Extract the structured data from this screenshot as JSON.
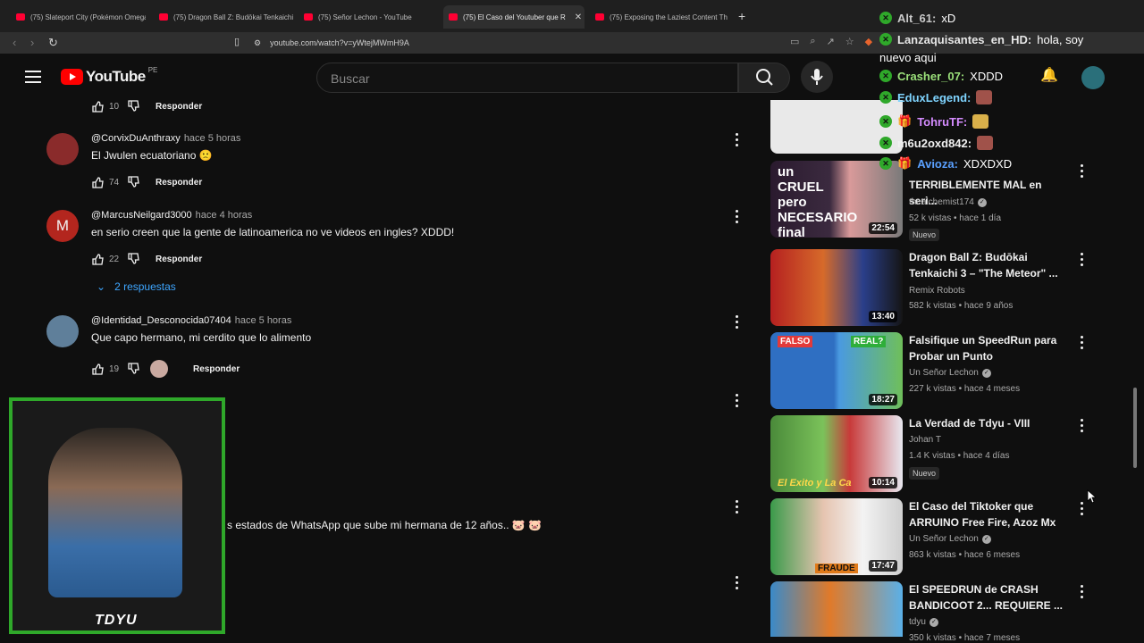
{
  "browser": {
    "tabs": [
      {
        "label": "(75) Slateport City (Pokémon Omega"
      },
      {
        "label": "(75) Dragon Ball Z: Budōkai Tenkaichi"
      },
      {
        "label": "(75) Señor Lechon - YouTube"
      },
      {
        "label": "(75) El Caso del Youtuber que R"
      },
      {
        "label": "(75) Exposing the Laziest Content Th"
      }
    ],
    "new_tab": "+",
    "url": "youtube.com/watch?v=yWtejMWmH9A"
  },
  "header": {
    "logo_text": "YouTube",
    "country": "PE",
    "search_placeholder": "Buscar"
  },
  "comments": {
    "top_likes": "10",
    "reply_label": "Responder",
    "items": [
      {
        "author": "@CorvixDuAnthraxy",
        "time": "hace 5 horas",
        "text": "El Jwulen ecuatoriano 🙁",
        "likes": "74"
      },
      {
        "author": "@MarcusNeilgard3000",
        "time": "hace 4 horas",
        "text": "en serio creen que la gente de latinoamerica no ve videos en ingles? XDDD!",
        "likes": "22",
        "avatar_letter": "M"
      },
      {
        "author": "@Identidad_Desconocida07404",
        "time": "hace 5 horas",
        "text": "Que capo hermano, mi cerdito que lo alimento",
        "likes": "19"
      }
    ],
    "replies_toggle": "2 respuestas",
    "partial_text": "s estados de WhatsApp que sube mi hermana de 12 años.. 🐷 🐷"
  },
  "sidebar": {
    "videos": [
      {
        "title": "TERRIBLEMENTE MAL en seri...",
        "channel": "thealchemist174",
        "meta": "52 k vistas • hace 1 día",
        "badge": "Nuevo",
        "duration": "22:54"
      },
      {
        "title": "Dragon Ball Z: Budōkai Tenkaichi 3 – \"The Meteor\" ...",
        "channel": "Remix Robots",
        "meta": "582 k vistas • hace 9 años",
        "duration": "13:40"
      },
      {
        "title": "Falsifique un SpeedRun para Probar un Punto",
        "channel": "Un Señor Lechon",
        "meta": "227 k vistas • hace 4 meses",
        "duration": "18:27"
      },
      {
        "title": "La Verdad de Tdyu - VIII",
        "channel": "Johan T",
        "meta": "1.4 K vistas • hace 4 días",
        "badge": "Nuevo",
        "duration": "10:14"
      },
      {
        "title": "El Caso del Tiktoker que ARRUINO Free Fire, Azoz Mx",
        "channel": "Un Señor Lechon",
        "meta": "863 k vistas • hace 6 meses",
        "duration": "17:47"
      },
      {
        "title": "El SPEEDRUN de CRASH BANDICOOT 2... REQUIERE ...",
        "channel": "tdyu",
        "meta": "350 k vistas • hace 7 meses"
      }
    ],
    "thumb_texts": {
      "cruel": "un CRUEL pero NECESARIO final",
      "falso": "FALSO",
      "real": "REAL?",
      "fraude": "FRAUDE",
      "exito": "El Exito y La Ca"
    }
  },
  "webcam": {
    "tag": "TDYU"
  },
  "chat": [
    {
      "user": "Alt_61:",
      "msg": "xD",
      "color": "#c9c9c9"
    },
    {
      "user": "Lanzaquisantes_en_HD:",
      "msg": "hola, soy",
      "color": "#e6e6e6"
    },
    {
      "user": "",
      "msg": "nuevo aqui",
      "color": "#e6e6e6"
    },
    {
      "user": "Crasher_07:",
      "msg": "XDDD",
      "color": "#9be07a"
    },
    {
      "user": "EduxLegend:",
      "msg": "",
      "color": "#7fd4ff"
    },
    {
      "user": "TohruTF:",
      "msg": "",
      "color": "#d58cff"
    },
    {
      "user": "m6u2oxd842:",
      "msg": "",
      "color": "#f1f1f1"
    },
    {
      "user": "Avioza:",
      "msg": "XDXDXD",
      "color": "#5aa0ff"
    }
  ]
}
